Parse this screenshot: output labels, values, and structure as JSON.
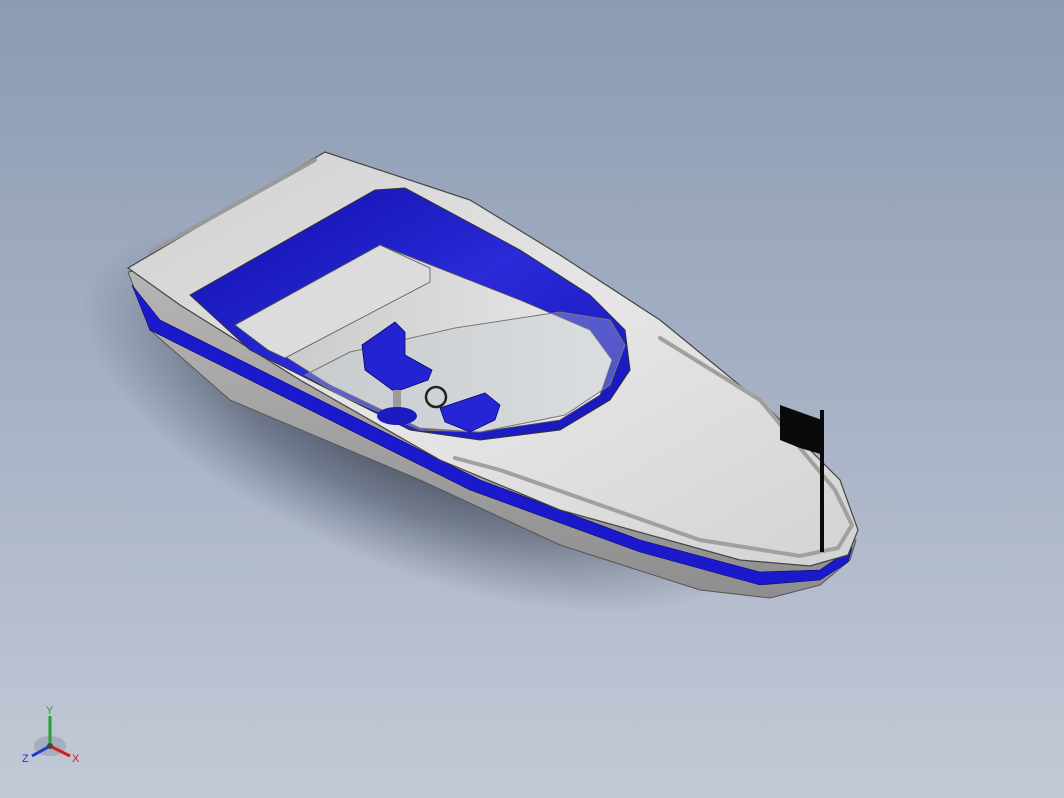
{
  "viewport": {
    "background_top": "#8b9bb3",
    "background_bottom": "#c3c9d6"
  },
  "model": {
    "hull_color": "#dedede",
    "accent_color": "#1a1acc",
    "flag_color": "#0a0a0a"
  },
  "triad": {
    "x_label": "X",
    "y_label": "Y",
    "z_label": "Z",
    "x_color": "#d21e1e",
    "y_color": "#22a032",
    "z_color": "#2238c8"
  }
}
